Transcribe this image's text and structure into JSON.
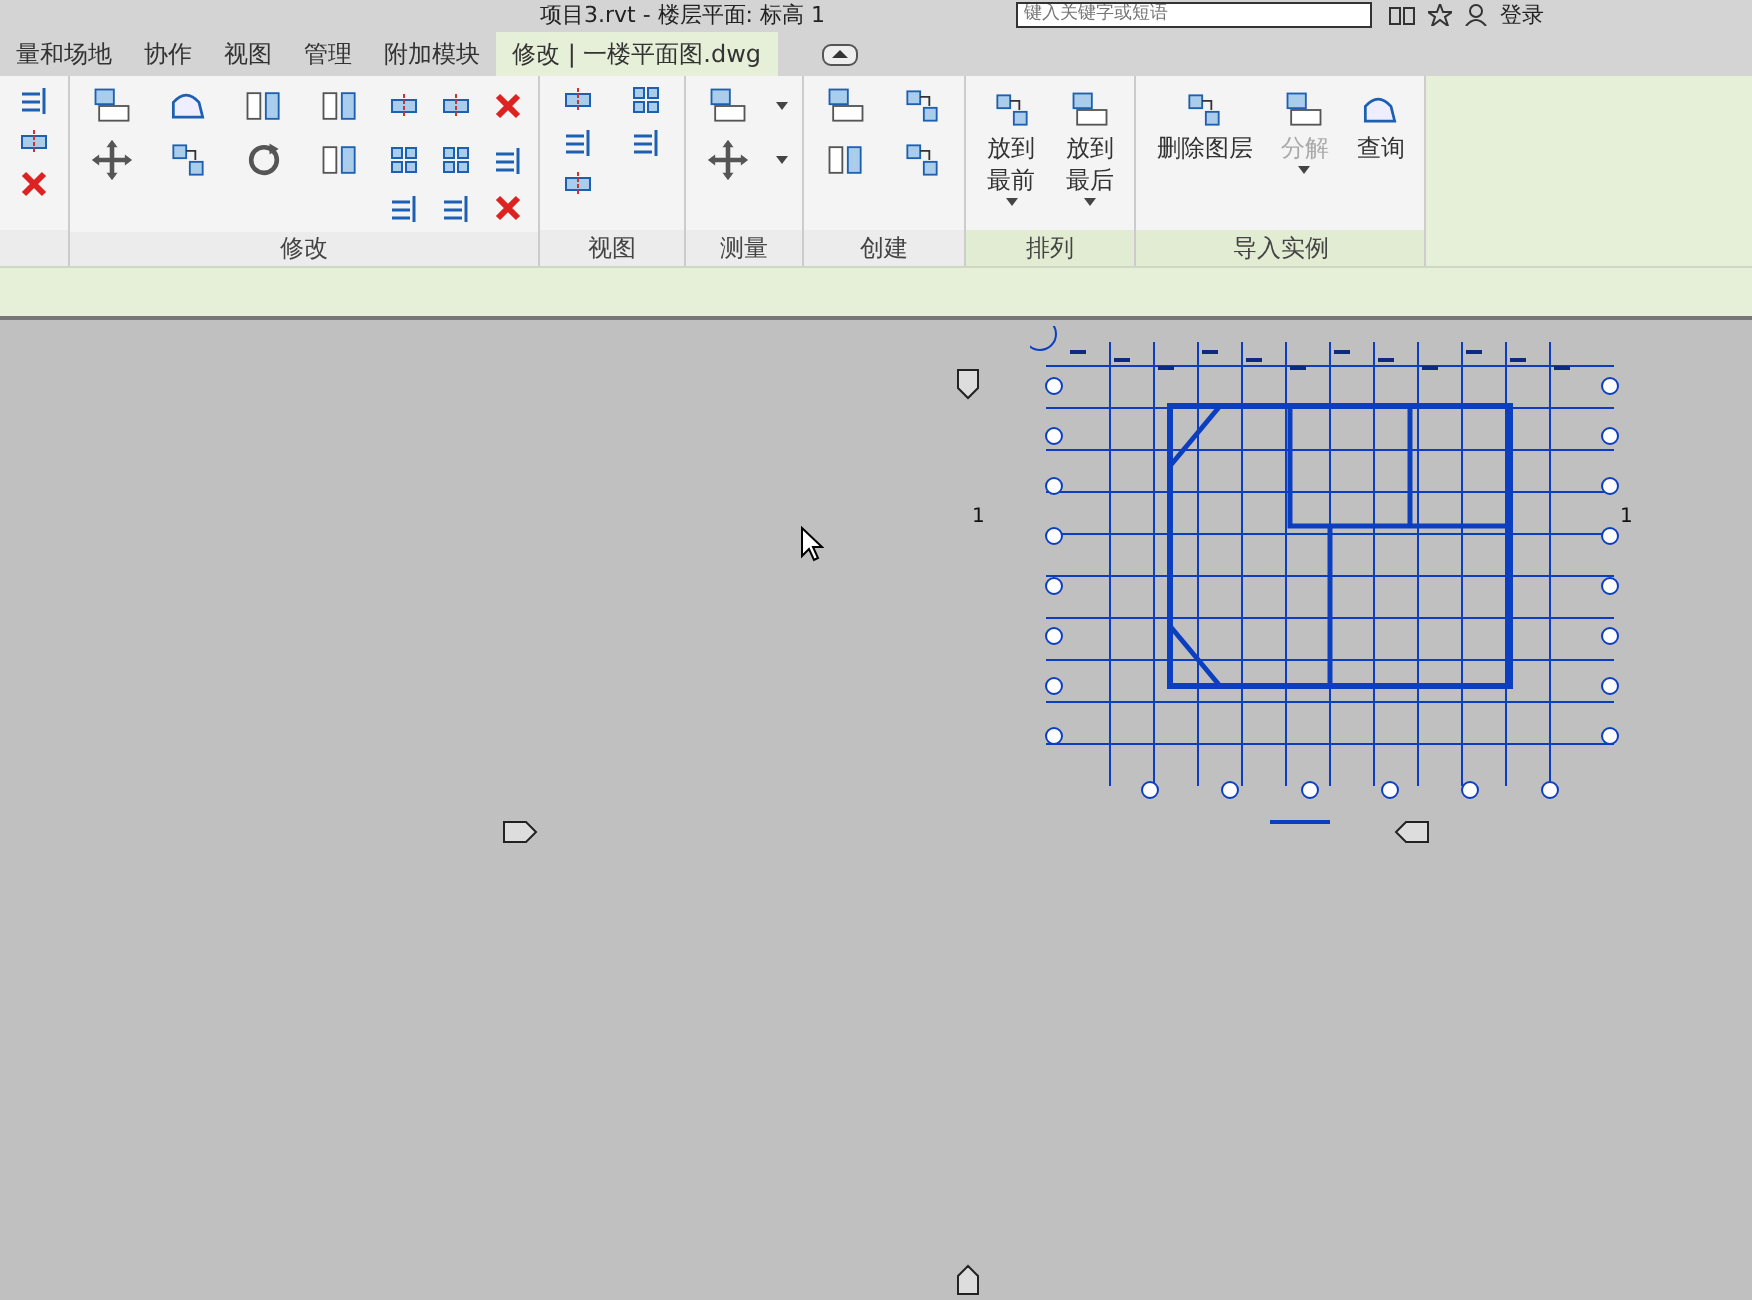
{
  "title_bar": {
    "title": "项目3.rvt - 楼层平面: 标高 1",
    "search": {
      "placeholder": "键入关键字或短语"
    },
    "sign_in": "登录"
  },
  "tabs": [
    {
      "label": "量和场地",
      "selected": false
    },
    {
      "label": "协作",
      "selected": false
    },
    {
      "label": "视图",
      "selected": false
    },
    {
      "label": "管理",
      "selected": false
    },
    {
      "label": "附加模块",
      "selected": false
    },
    {
      "label": "修改 | 一楼平面图.dwg",
      "selected": true
    }
  ],
  "ribbon": {
    "panels": [
      {
        "kind": "partial",
        "contextual": false
      },
      {
        "kind": "modify",
        "label": "修改",
        "contextual": false
      },
      {
        "kind": "view",
        "label": "视图",
        "contextual": false
      },
      {
        "kind": "measure",
        "label": "测量",
        "contextual": false
      },
      {
        "kind": "create",
        "label": "创建",
        "contextual": false
      },
      {
        "kind": "arrange",
        "label": "排列",
        "contextual": true,
        "buttons": [
          {
            "label": "放到最前",
            "dropdown": true,
            "disabled": false
          },
          {
            "label": "放到最后",
            "dropdown": true,
            "disabled": false
          }
        ]
      },
      {
        "kind": "import",
        "label": "导入实例",
        "contextual": true,
        "buttons": [
          {
            "label": "删除图层",
            "dropdown": false,
            "disabled": false
          },
          {
            "label": "分解",
            "dropdown": true,
            "disabled": true
          },
          {
            "label": "查询",
            "dropdown": false,
            "disabled": false
          }
        ]
      }
    ]
  },
  "canvas": {
    "section_marks": [
      {
        "label": "1"
      },
      {
        "label": "1"
      }
    ]
  }
}
